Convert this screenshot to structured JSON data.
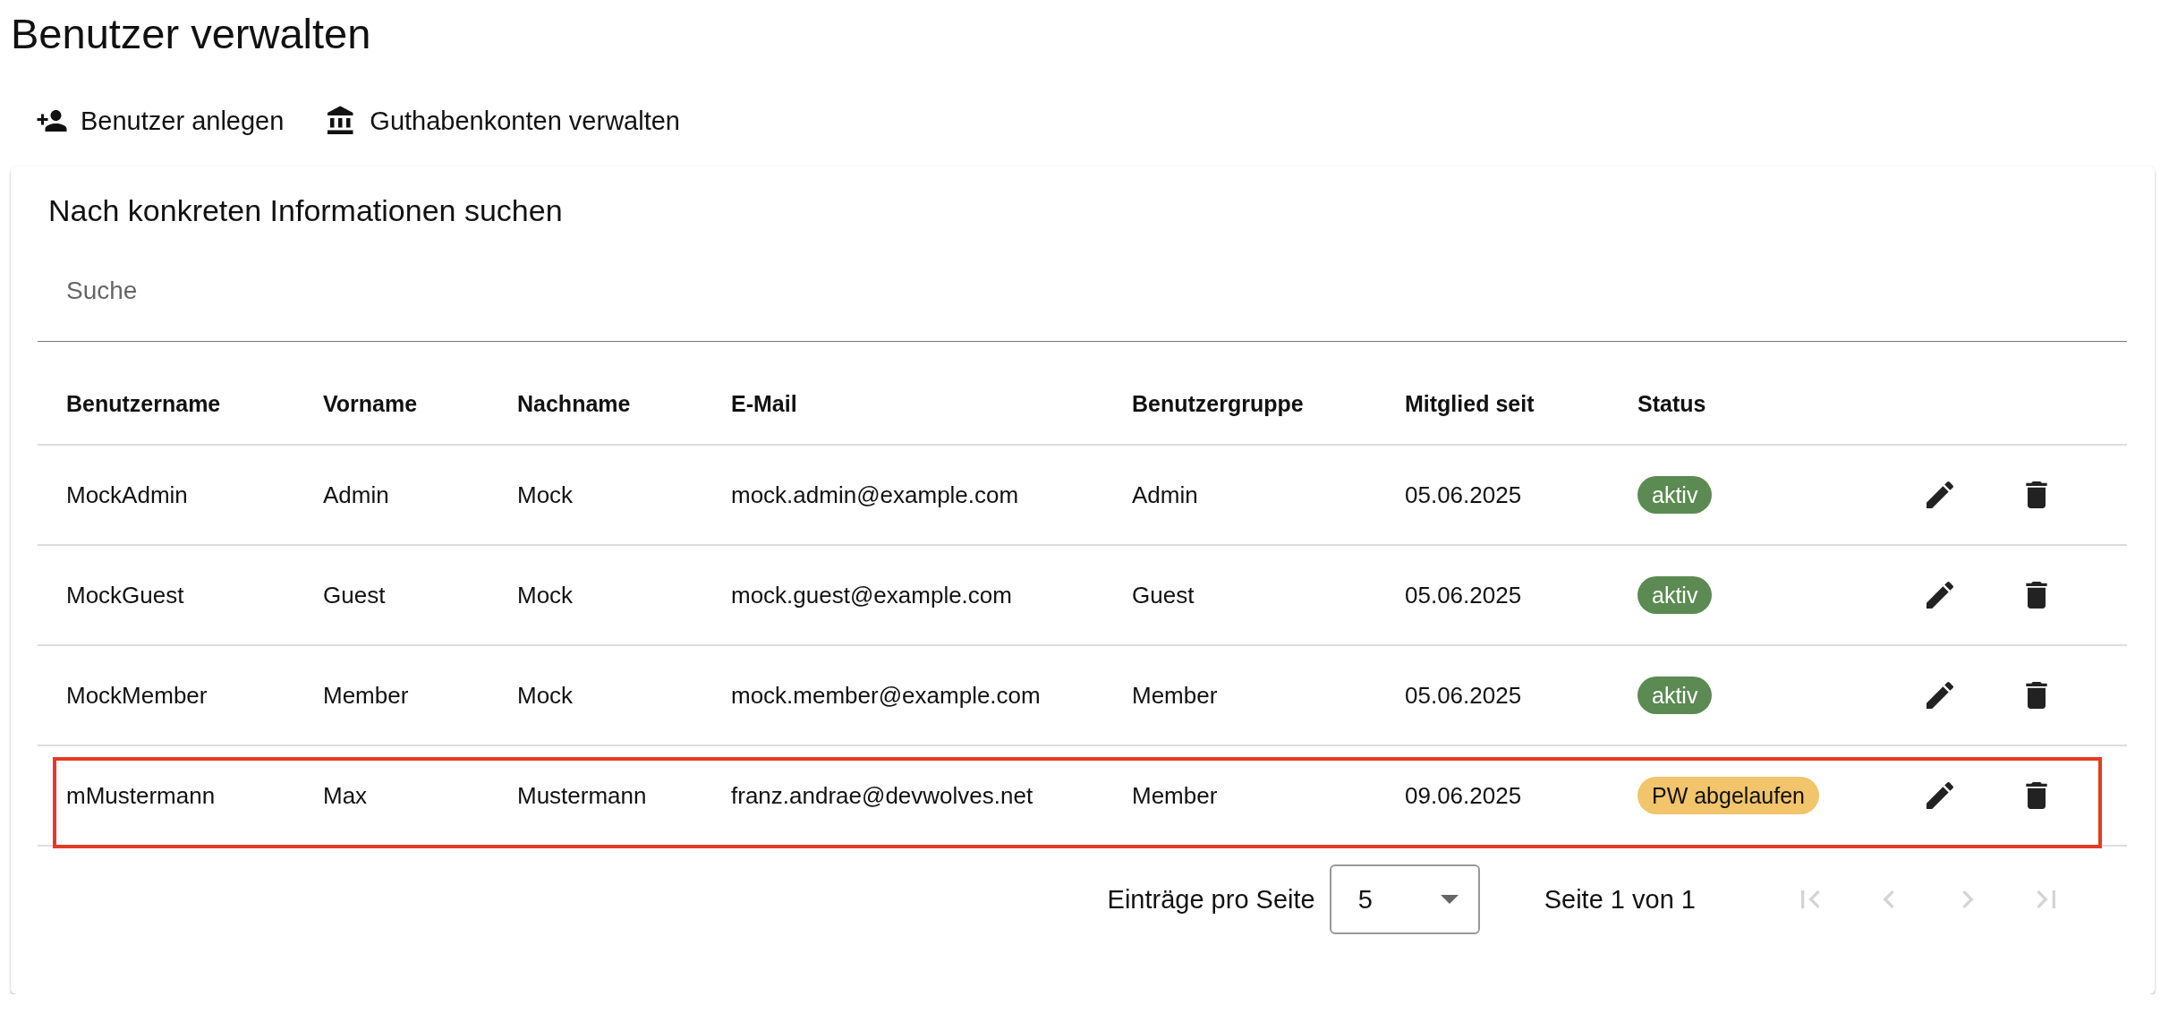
{
  "page": {
    "title": "Benutzer verwalten"
  },
  "toolbar": [
    {
      "label": "Benutzer anlegen",
      "kind": "add-user"
    },
    {
      "label": "Guthabenkonten verwalten",
      "kind": "bank"
    }
  ],
  "card": {
    "title": "Nach konkreten Informationen suchen"
  },
  "search": {
    "placeholder": "Suche"
  },
  "table": {
    "columns": [
      "Benutzername",
      "Vorname",
      "Nachname",
      "E-Mail",
      "Benutzergruppe",
      "Mitglied seit",
      "Status"
    ],
    "rows": [
      {
        "cells": [
          "MockAdmin",
          "Admin",
          "Mock",
          "mock.admin@example.com",
          "Admin",
          "05.06.2025"
        ],
        "status": {
          "label": "aktiv",
          "kind": "active"
        },
        "highlighted": false
      },
      {
        "cells": [
          "MockGuest",
          "Guest",
          "Mock",
          "mock.guest@example.com",
          "Guest",
          "05.06.2025"
        ],
        "status": {
          "label": "aktiv",
          "kind": "active"
        },
        "highlighted": false
      },
      {
        "cells": [
          "MockMember",
          "Member",
          "Mock",
          "mock.member@example.com",
          "Member",
          "05.06.2025"
        ],
        "status": {
          "label": "aktiv",
          "kind": "active"
        },
        "highlighted": false
      },
      {
        "cells": [
          "mMustermann",
          "Max",
          "Mustermann",
          "franz.andrae@devwolves.net",
          "Member",
          "09.06.2025"
        ],
        "status": {
          "label": "PW abgelaufen",
          "kind": "expired"
        },
        "highlighted": true
      }
    ]
  },
  "pagination": {
    "label": "Einträge pro Seite",
    "page_size": "5",
    "page_info": "Seite 1 von 1",
    "buttons": [
      {
        "kind": "first",
        "disabled": true
      },
      {
        "kind": "previous",
        "disabled": true
      },
      {
        "kind": "next",
        "disabled": true
      },
      {
        "kind": "last",
        "disabled": true
      }
    ]
  }
}
